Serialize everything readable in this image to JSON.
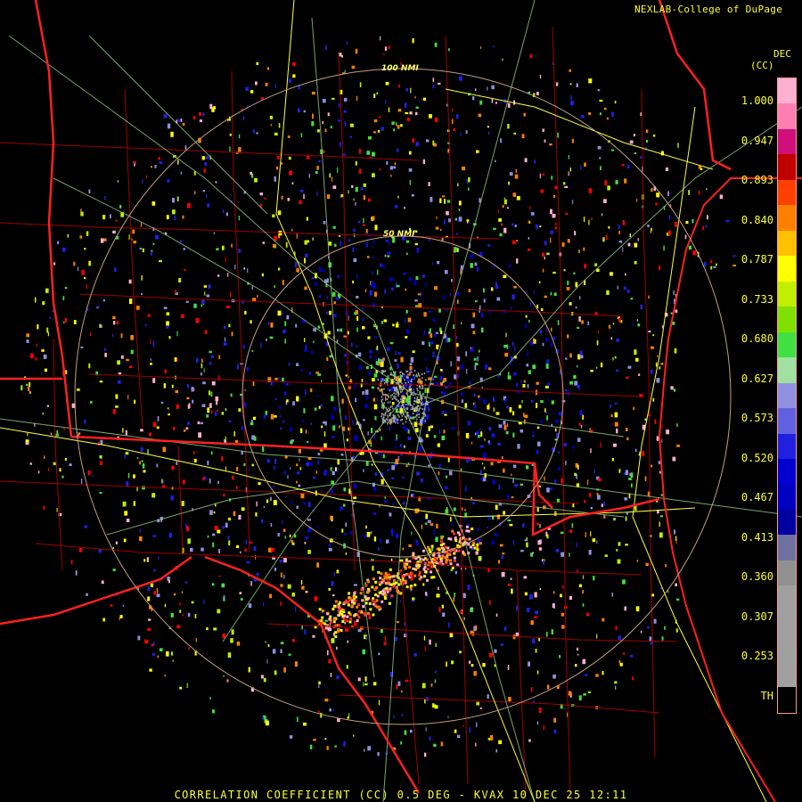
{
  "header": {
    "credit": "NEXLAB-College of DuPage"
  },
  "product": {
    "abbr": "DEC",
    "unit": "(CC)"
  },
  "colorbar": {
    "tick_labels": [
      "1.000",
      "0.947",
      "0.893",
      "0.840",
      "0.787",
      "0.733",
      "0.680",
      "0.627",
      "0.573",
      "0.520",
      "0.467",
      "0.413",
      "0.360",
      "0.307",
      "0.253",
      "TH"
    ],
    "colors": [
      "#ffb0d0",
      "#ff80b0",
      "#d0107a",
      "#c00000",
      "#ff4000",
      "#ff8000",
      "#ffc000",
      "#ffff00",
      "#c0f000",
      "#80e000",
      "#40e040",
      "#a0e0a0",
      "#9090e0",
      "#6060e0",
      "#2020e0",
      "#0000d0",
      "#0000c0",
      "#0000a0",
      "#7070a0",
      "#909090",
      "#a0a0a0",
      "#a0a0a0",
      "#a0a0a0",
      "#a0a0a0",
      "#000000"
    ]
  },
  "rings": {
    "inner_label": "50 NMI",
    "outer_label": "100 NMI"
  },
  "caption": "CORRELATION COEFFICIENT (CC) 0.5 DEG - KVAX 10 DEC 25 12:11",
  "colors": {
    "state_border": "#ff2020",
    "county_border": "#a00000",
    "highway": "#90c080",
    "interstate": "#ffff40",
    "ring": "#c0a080",
    "text": "#ffff33"
  }
}
